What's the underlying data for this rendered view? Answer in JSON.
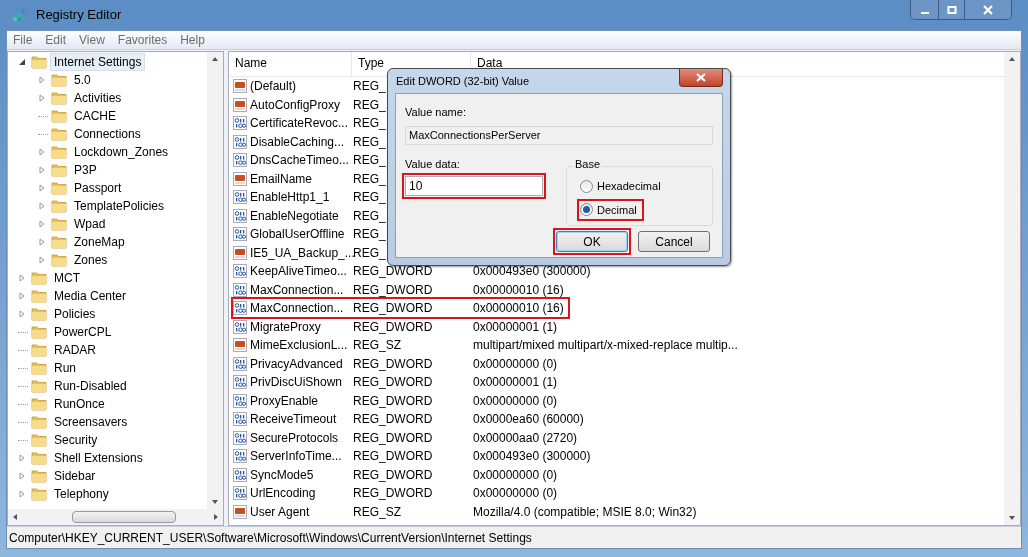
{
  "window": {
    "title": "Registry Editor"
  },
  "menu": [
    "File",
    "Edit",
    "View",
    "Favorites",
    "Help"
  ],
  "tree": [
    {
      "label": "Internet Settings",
      "kind": "branch",
      "expanded": true,
      "selected": true,
      "children": [
        {
          "label": "5.0",
          "kind": "branch",
          "expanded": false,
          "selected": false
        },
        {
          "label": "Activities",
          "kind": "branch",
          "expanded": false,
          "selected": false
        },
        {
          "label": "CACHE",
          "kind": "leaf",
          "selected": false
        },
        {
          "label": "Connections",
          "kind": "leaf",
          "selected": false
        },
        {
          "label": "Lockdown_Zones",
          "kind": "branch",
          "expanded": false,
          "selected": false
        },
        {
          "label": "P3P",
          "kind": "branch",
          "expanded": false,
          "selected": false
        },
        {
          "label": "Passport",
          "kind": "branch",
          "expanded": false,
          "selected": false
        },
        {
          "label": "TemplatePolicies",
          "kind": "branch",
          "expanded": false,
          "selected": false
        },
        {
          "label": "Wpad",
          "kind": "branch",
          "expanded": false,
          "selected": false
        },
        {
          "label": "ZoneMap",
          "kind": "branch",
          "expanded": false,
          "selected": false
        },
        {
          "label": "Zones",
          "kind": "branch",
          "expanded": false,
          "selected": false
        }
      ]
    },
    {
      "label": "MCT",
      "kind": "branch",
      "expanded": false,
      "selected": false
    },
    {
      "label": "Media Center",
      "kind": "branch",
      "expanded": false,
      "selected": false
    },
    {
      "label": "Policies",
      "kind": "branch",
      "expanded": false,
      "selected": false
    },
    {
      "label": "PowerCPL",
      "kind": "leaf",
      "selected": false
    },
    {
      "label": "RADAR",
      "kind": "leaf",
      "selected": false
    },
    {
      "label": "Run",
      "kind": "leaf",
      "selected": false
    },
    {
      "label": "Run-Disabled",
      "kind": "leaf",
      "selected": false
    },
    {
      "label": "RunOnce",
      "kind": "leaf",
      "selected": false
    },
    {
      "label": "Screensavers",
      "kind": "leaf",
      "selected": false
    },
    {
      "label": "Security",
      "kind": "leaf",
      "selected": false
    },
    {
      "label": "Shell Extensions",
      "kind": "branch",
      "expanded": false,
      "selected": false
    },
    {
      "label": "Sidebar",
      "kind": "branch",
      "expanded": false,
      "selected": false
    },
    {
      "label": "Telephony",
      "kind": "branch",
      "expanded": false,
      "selected": false
    }
  ],
  "table": {
    "columns": [
      "Name",
      "Type",
      "Data"
    ],
    "rows": [
      {
        "kind": "sz",
        "name": "(Default)",
        "type": "REG_",
        "highlighted": false
      },
      {
        "kind": "sz",
        "name": "AutoConfigProxy",
        "type": "REG_",
        "highlighted": false
      },
      {
        "kind": "dword",
        "name": "CertificateRevoc...",
        "type": "REG_",
        "highlighted": false
      },
      {
        "kind": "dword",
        "name": "DisableCaching...",
        "type": "REG_",
        "highlighted": false
      },
      {
        "kind": "dword",
        "name": "DnsCacheTimeo...",
        "type": "REG_",
        "highlighted": false
      },
      {
        "kind": "sz",
        "name": "EmailName",
        "type": "REG_",
        "highlighted": false
      },
      {
        "kind": "dword",
        "name": "EnableHttp1_1",
        "type": "REG_",
        "highlighted": false
      },
      {
        "kind": "dword",
        "name": "EnableNegotiate",
        "type": "REG_",
        "highlighted": false
      },
      {
        "kind": "dword",
        "name": "GlobalUserOffline",
        "type": "REG_",
        "highlighted": false
      },
      {
        "kind": "sz",
        "name": "IE5_UA_Backup_...",
        "type": "REG_",
        "highlighted": false
      },
      {
        "kind": "dword",
        "name": "KeepAliveTimeo...",
        "type": "REG_DWORD",
        "data": "0x000493e0 (300000)",
        "highlighted": false
      },
      {
        "kind": "dword",
        "name": "MaxConnection...",
        "type": "REG_DWORD",
        "data": "0x00000010 (16)",
        "highlighted": false
      },
      {
        "kind": "dword",
        "name": "MaxConnection...",
        "type": "REG_DWORD",
        "data": "0x00000010 (16)",
        "highlighted": true
      },
      {
        "kind": "dword",
        "name": "MigrateProxy",
        "type": "REG_DWORD",
        "data": "0x00000001 (1)",
        "highlighted": false
      },
      {
        "kind": "sz",
        "name": "MimeExclusionL...",
        "type": "REG_SZ",
        "data": "multipart/mixed multipart/x-mixed-replace multip...",
        "highlighted": false
      },
      {
        "kind": "dword",
        "name": "PrivacyAdvanced",
        "type": "REG_DWORD",
        "data": "0x00000000 (0)",
        "highlighted": false
      },
      {
        "kind": "dword",
        "name": "PrivDiscUiShown",
        "type": "REG_DWORD",
        "data": "0x00000001 (1)",
        "highlighted": false
      },
      {
        "kind": "dword",
        "name": "ProxyEnable",
        "type": "REG_DWORD",
        "data": "0x00000000 (0)",
        "highlighted": false
      },
      {
        "kind": "dword",
        "name": "ReceiveTimeout",
        "type": "REG_DWORD",
        "data": "0x0000ea60 (60000)",
        "highlighted": false
      },
      {
        "kind": "dword",
        "name": "SecureProtocols",
        "type": "REG_DWORD",
        "data": "0x00000aa0 (2720)",
        "highlighted": false
      },
      {
        "kind": "dword",
        "name": "ServerInfoTime...",
        "type": "REG_DWORD",
        "data": "0x000493e0 (300000)",
        "highlighted": false
      },
      {
        "kind": "dword",
        "name": "SyncMode5",
        "type": "REG_DWORD",
        "data": "0x00000000 (0)",
        "highlighted": false
      },
      {
        "kind": "dword",
        "name": "UrlEncoding",
        "type": "REG_DWORD",
        "data": "0x00000000 (0)",
        "highlighted": false
      },
      {
        "kind": "sz",
        "name": "User Agent",
        "type": "REG_SZ",
        "data": "Mozilla/4.0 (compatible; MSIE 8.0; Win32)",
        "highlighted": false
      }
    ]
  },
  "status_bar": "Computer\\HKEY_CURRENT_USER\\Software\\Microsoft\\Windows\\CurrentVersion\\Internet Settings",
  "dialog": {
    "title": "Edit DWORD (32-bit) Value",
    "value_name_label": "Value name:",
    "value_name": "MaxConnectionsPerServer",
    "value_data_label": "Value data:",
    "value_data": "10",
    "value_data_highlighted": true,
    "base_label": "Base",
    "bases": [
      {
        "label": "Hexadecimal",
        "selected": false,
        "highlighted": false
      },
      {
        "label": "Decimal",
        "selected": true,
        "highlighted": true
      }
    ],
    "buttons": [
      {
        "label": "OK",
        "default": true,
        "highlighted": true
      },
      {
        "label": "Cancel",
        "default": false,
        "highlighted": false
      }
    ]
  }
}
